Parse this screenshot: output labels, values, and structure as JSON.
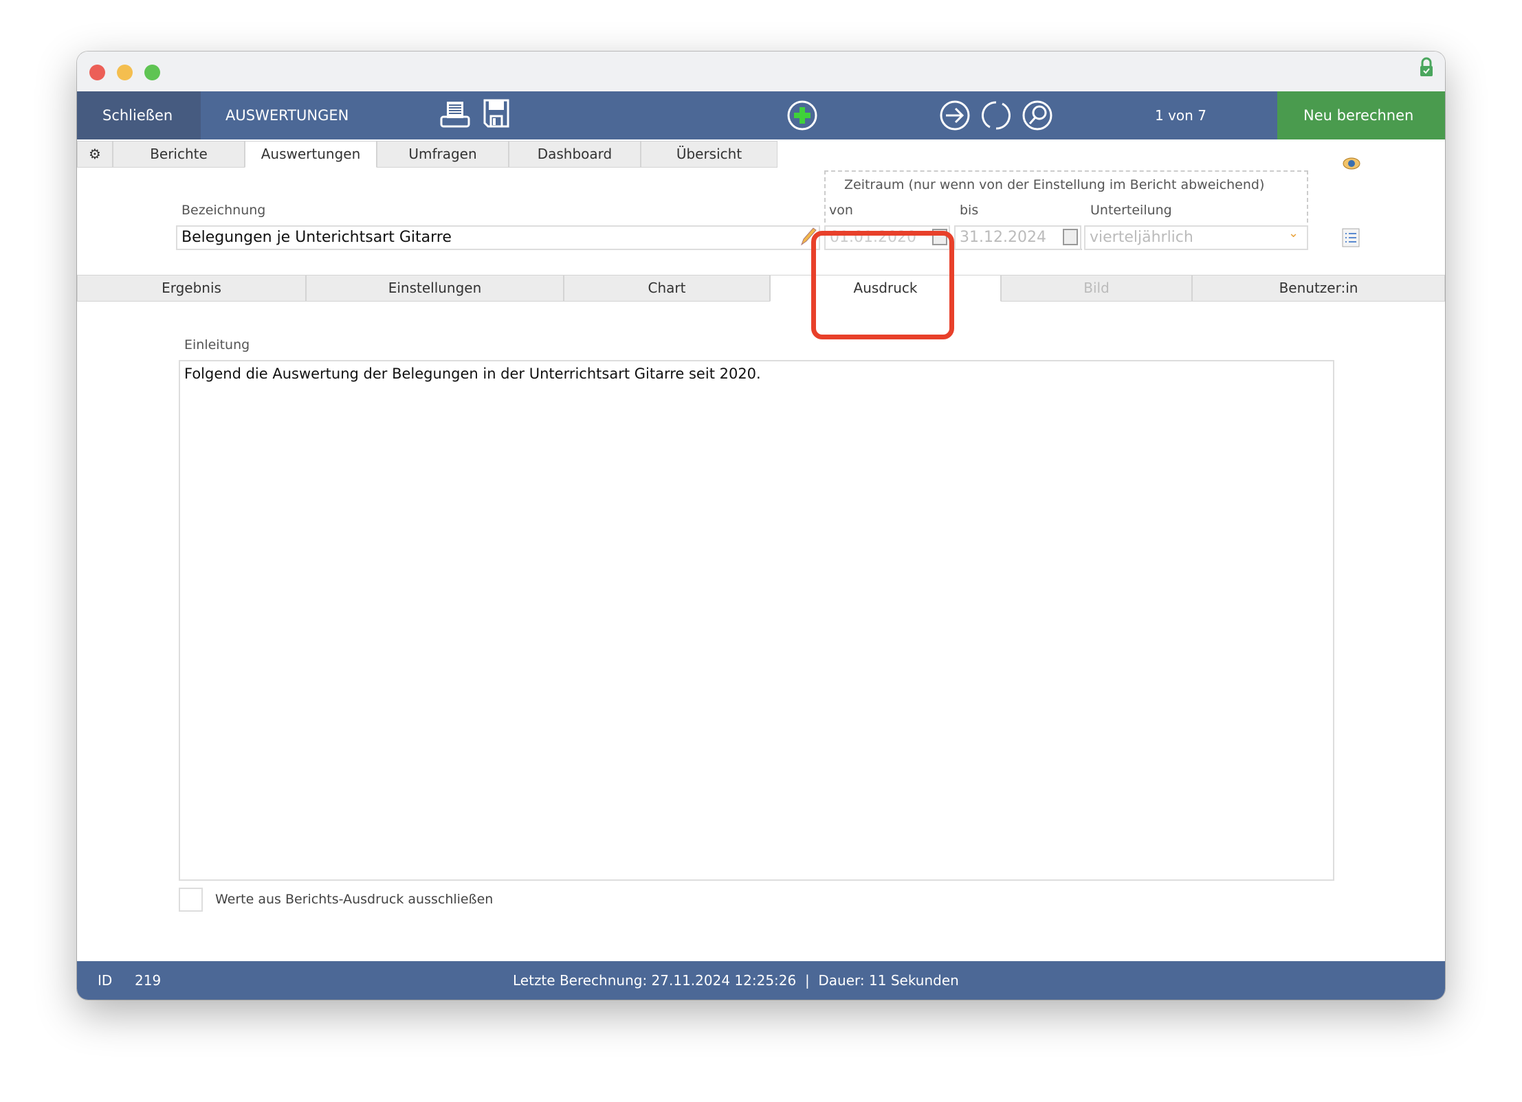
{
  "toolbar": {
    "close": "Schließen",
    "title": "AUSWERTUNGEN",
    "pager": "1 von 7",
    "recalc": "Neu berechnen"
  },
  "tabs_top": [
    "Berichte",
    "Auswertungen",
    "Umfragen",
    "Dashboard",
    "Übersicht"
  ],
  "form": {
    "name_label": "Bezeichnung",
    "name_value": "Belegungen je Unterichtsart Gitarre",
    "period_title": "Zeitraum (nur wenn von der Einstellung im Bericht abweichend)",
    "from_label": "von",
    "from_value": "01.01.2020",
    "to_label": "bis",
    "to_value": "31.12.2024",
    "division_label": "Unterteilung",
    "division_value": "vierteljährlich"
  },
  "tabs_sub": [
    "Ergebnis",
    "Einstellungen",
    "Chart",
    "Ausdruck",
    "Bild",
    "Benutzer:in"
  ],
  "content": {
    "intro_label": "Einleitung",
    "intro_text": "Folgend die Auswertung der Belegungen in der Unterrichtsart Gitarre seit 2020.",
    "exclude_label": "Werte aus Berichts-Ausdruck ausschließen"
  },
  "footer": {
    "id_label": "ID",
    "id_value": "219",
    "status": "Letzte Berechnung: 27.11.2024 12:25:26  |  Dauer: 11 Sekunden"
  },
  "colors": {
    "toolbar": "#4c6896",
    "recalc": "#4a9b4e",
    "highlight": "#e8402a"
  }
}
